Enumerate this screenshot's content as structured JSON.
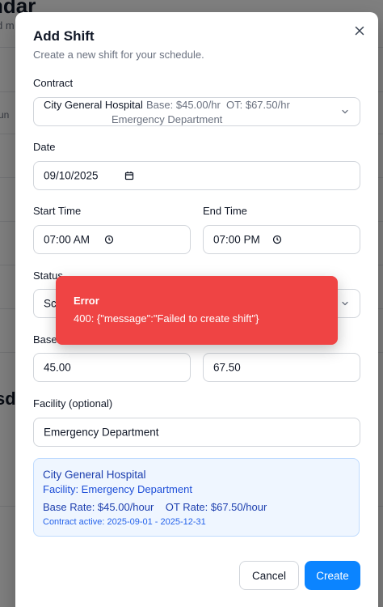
{
  "background": {
    "title": "ndar",
    "subtitle": "d m",
    "row_label": "un",
    "big_label": "sd"
  },
  "modal": {
    "title": "Add Shift",
    "description": "Create a new shift for your schedule.",
    "contract": {
      "label": "Contract",
      "name": "City General Hospital",
      "rates": "Base: $45.00/hr  OT: $67.50/hr",
      "facility": "Emergency Department"
    },
    "date": {
      "label": "Date",
      "value": "09/10/2025"
    },
    "start_time": {
      "label": "Start Time",
      "value": "07:00 AM"
    },
    "end_time": {
      "label": "End Time",
      "value": "07:00 PM"
    },
    "status": {
      "label": "Status",
      "value": "Sc"
    },
    "base_rate": {
      "label": "Base",
      "value": "45.00"
    },
    "ot_rate": {
      "value": "67.50"
    },
    "facility": {
      "label": "Facility (optional)",
      "value": "Emergency Department"
    },
    "summary": {
      "hospital": "City General Hospital",
      "facility_line": "Facility: Emergency Department",
      "rates_line": "Base Rate: $45.00/hour    OT Rate: $67.50/hour",
      "contract_line": "Contract active: 2025-09-01 - 2025-12-31"
    },
    "buttons": {
      "cancel": "Cancel",
      "create": "Create"
    }
  },
  "toast": {
    "title": "Error",
    "message": "400: {\"message\":\"Failed to create shift\"}"
  },
  "colors": {
    "primary": "#0b84ff",
    "error": "#ef4444",
    "info_bg": "#eff6ff",
    "info_text": "#1e40af"
  },
  "icons": {
    "close": "close-icon",
    "chevron": "chevron-down-icon",
    "calendar": "calendar-icon",
    "clock": "clock-icon"
  }
}
